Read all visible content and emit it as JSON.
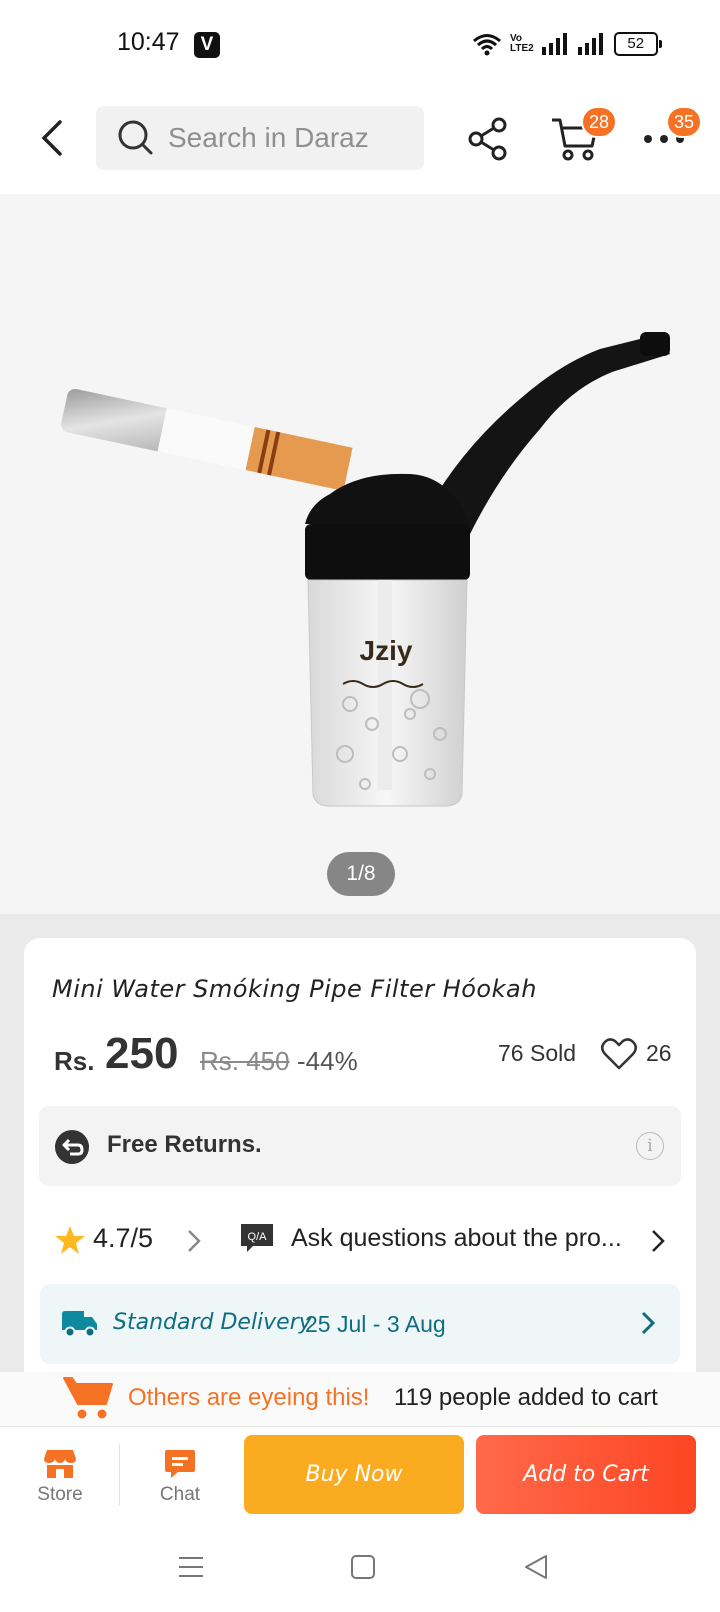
{
  "status_bar": {
    "time": "10:47",
    "app_icon_letter": "V",
    "volte": "Vo\nLTE2",
    "battery": "52"
  },
  "header": {
    "back_icon": "chevron-left-icon",
    "search_placeholder": "Search in Daraz",
    "share_icon": "share-icon",
    "cart_icon": "cart-icon",
    "cart_badge": "28",
    "more_icon": "more-dots-icon",
    "more_badge": "35"
  },
  "gallery": {
    "counter": "1/8"
  },
  "product": {
    "title": "Mini Water Smóking Pipe Filter Hóokah",
    "currency": "Rs.",
    "price": "250",
    "original_price": "Rs. 450",
    "discount": "-44%",
    "sold": "76 Sold",
    "wishlist_count": "26"
  },
  "returns": {
    "label": "Free Returns."
  },
  "rating": {
    "value": "4.7/5",
    "qa_badge": "Q/A",
    "qa_text": "Ask questions about the pro..."
  },
  "delivery": {
    "label": "Standard Delivery",
    "date": "25 Jul - 3 Aug"
  },
  "eyeing": {
    "highlight": "Others are eyeing this!",
    "text": "119 people added to cart"
  },
  "bottom_bar": {
    "store_label": "Store",
    "chat_label": "Chat",
    "buy_now": "Buy Now",
    "add_to_cart": "Add to Cart"
  },
  "colors": {
    "accent": "#f57224",
    "buy_now": "#fbab1f",
    "add_to_cart": "#fd4523",
    "delivery": "#0e6e80"
  }
}
